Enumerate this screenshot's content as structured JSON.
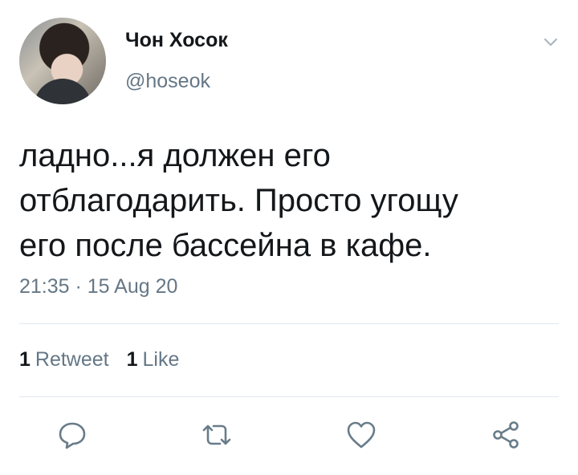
{
  "tweet": {
    "name": "Чон Хосок",
    "handle": "@hoseok",
    "text": "ладно...я должен его\nотблагодарить. Просто угощу\nего после бассейна в кафе.",
    "timestamp": "21:35 · 15 Aug 20",
    "retweets_count": "1",
    "retweets_label": "Retweet",
    "likes_count": "1",
    "likes_label": "Like"
  },
  "icons": {
    "menu": "chevron-down-icon",
    "reply": "reply-icon",
    "retweet": "retweet-icon",
    "like": "heart-icon",
    "share": "share-icon"
  },
  "colors": {
    "text": "#14171a",
    "secondary": "#657786",
    "icon": "#697c89",
    "divider": "#e1e8ed"
  }
}
